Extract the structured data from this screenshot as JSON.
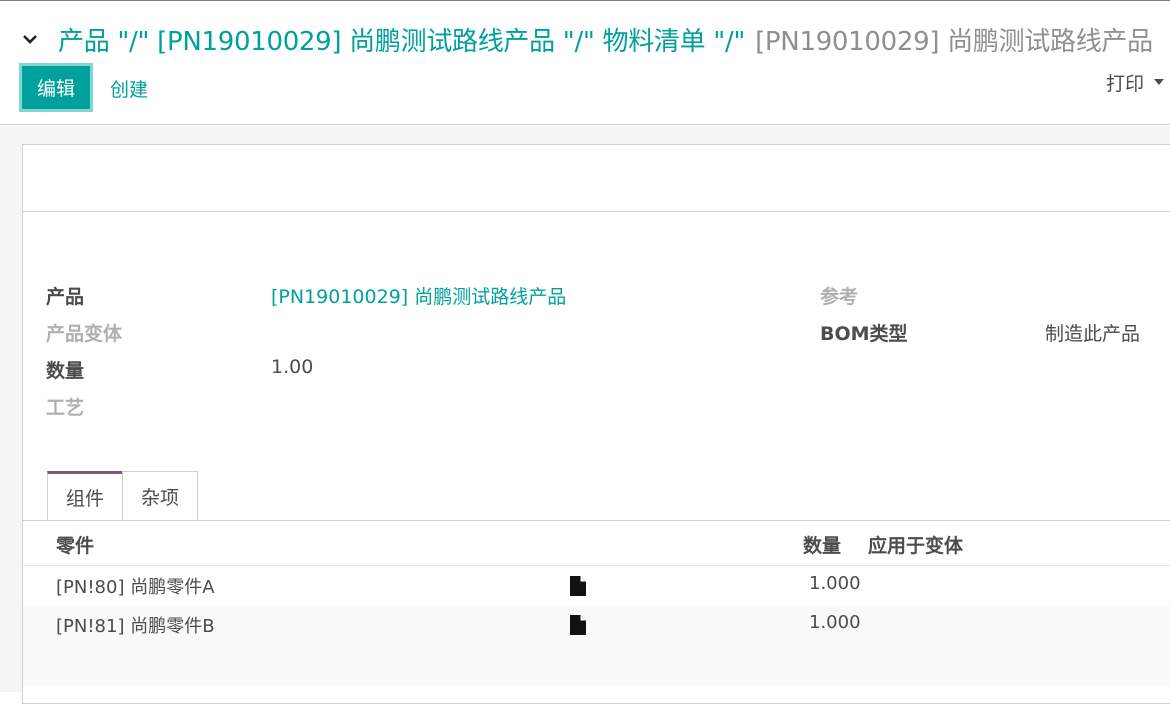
{
  "breadcrumb": {
    "part1": "产品 \"/\" [PN19010029] 尚鹏测试路线产品 \"/\" 物料清单 \"/\"",
    "active": "[PN19010029] 尚鹏测试路线产品"
  },
  "toolbar": {
    "edit_label": "编辑",
    "create_label": "创建",
    "print_label": "打印"
  },
  "form": {
    "product_label": "产品",
    "product_value": "[PN19010029] 尚鹏测试路线产品",
    "variant_label": "产品变体",
    "quantity_label": "数量",
    "quantity_value": "1.00",
    "routing_label": "工艺",
    "reference_label": "参考",
    "bom_type_label": "BOM类型",
    "bom_type_value": "制造此产品"
  },
  "tabs": [
    {
      "label": "组件"
    },
    {
      "label": "杂项"
    }
  ],
  "table": {
    "headers": {
      "component": "零件",
      "quantity": "数量",
      "variants": "应用于变体"
    },
    "rows": [
      {
        "component": "[PN!80] 尚鹏零件A",
        "quantity": "1.000"
      },
      {
        "component": "[PN!81] 尚鹏零件B",
        "quantity": "1.000"
      }
    ]
  },
  "colors": {
    "accent": "#00a09d",
    "tab_active_border": "#7c5a7c",
    "muted_label": "#b0b0b0"
  }
}
